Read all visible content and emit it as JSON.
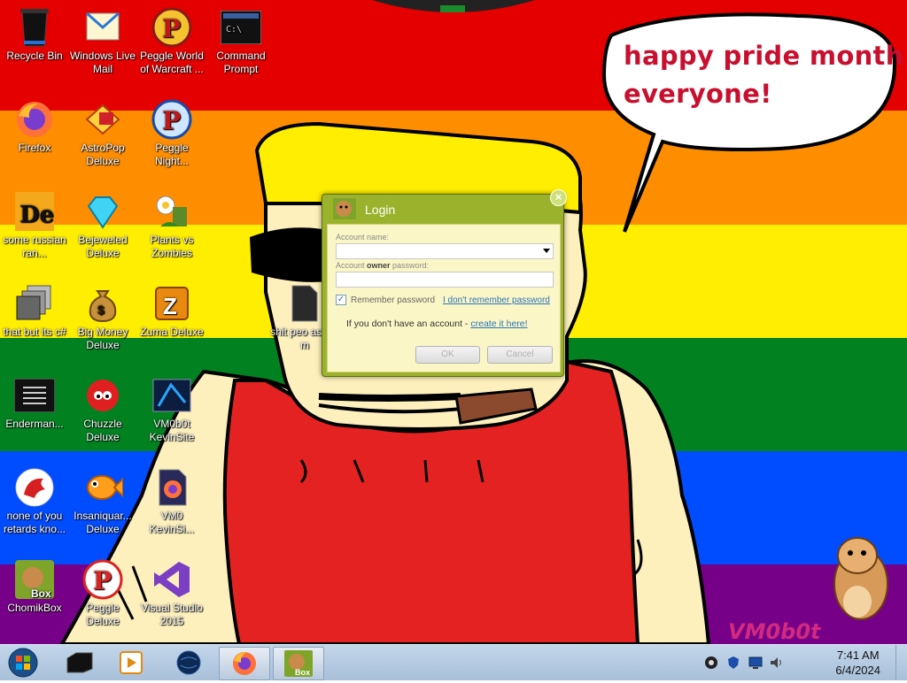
{
  "desktop": {
    "icons": [
      {
        "label": "Recycle Bin"
      },
      {
        "label": "Windows Live Mail"
      },
      {
        "label": "Peggle World of Warcraft ..."
      },
      {
        "label": "Command Prompt"
      },
      {
        "label": "Firefox"
      },
      {
        "label": "AstroPop Deluxe"
      },
      {
        "label": "Peggle Night..."
      },
      {
        "label": "some russian ran..."
      },
      {
        "label": "Bejeweled Deluxe"
      },
      {
        "label": "Plants vs Zombies"
      },
      {
        "label": "that but its c#"
      },
      {
        "label": "Big Money Deluxe"
      },
      {
        "label": "Zuma Deluxe"
      },
      {
        "label": "shit peo asked m"
      },
      {
        "label": "Enderman..."
      },
      {
        "label": "Chuzzle Deluxe"
      },
      {
        "label": "VM0b0t KevinSite"
      },
      {
        "label": "none of you retards kno..."
      },
      {
        "label": "Insaniquar... Deluxe"
      },
      {
        "label": "VM0 KevinSi..."
      },
      {
        "label": "ChomikBox"
      },
      {
        "label": "Peggle Deluxe"
      },
      {
        "label": "Visual Studio 2015"
      }
    ],
    "speech_bubble": {
      "line1": "happy pride month",
      "line2": "everyone!"
    },
    "watermark": "VM0b0t"
  },
  "login_dialog": {
    "title": "Login",
    "account_name_label": "Account name:",
    "account_name_value": "",
    "password_label_pre": "Account ",
    "password_label_bold": "owner",
    "password_label_post": " password:",
    "password_value": "",
    "remember_label": "Remember password",
    "remember_checked": true,
    "forgot_link": "I don't remember password",
    "no_account_text": "If you don't have an account - ",
    "create_link": "create it here!",
    "ok_label": "OK",
    "cancel_label": "Cancel",
    "close_glyph": "×"
  },
  "taskbar": {
    "clock_time": "7:41 AM",
    "clock_date": "6/4/2024"
  },
  "colors": {
    "rainbow": [
      "#e50000",
      "#ff8d00",
      "#ffee00",
      "#028121",
      "#004cff",
      "#770088"
    ],
    "dialog_frame": "#9bb32c",
    "link": "#2c74b8"
  }
}
